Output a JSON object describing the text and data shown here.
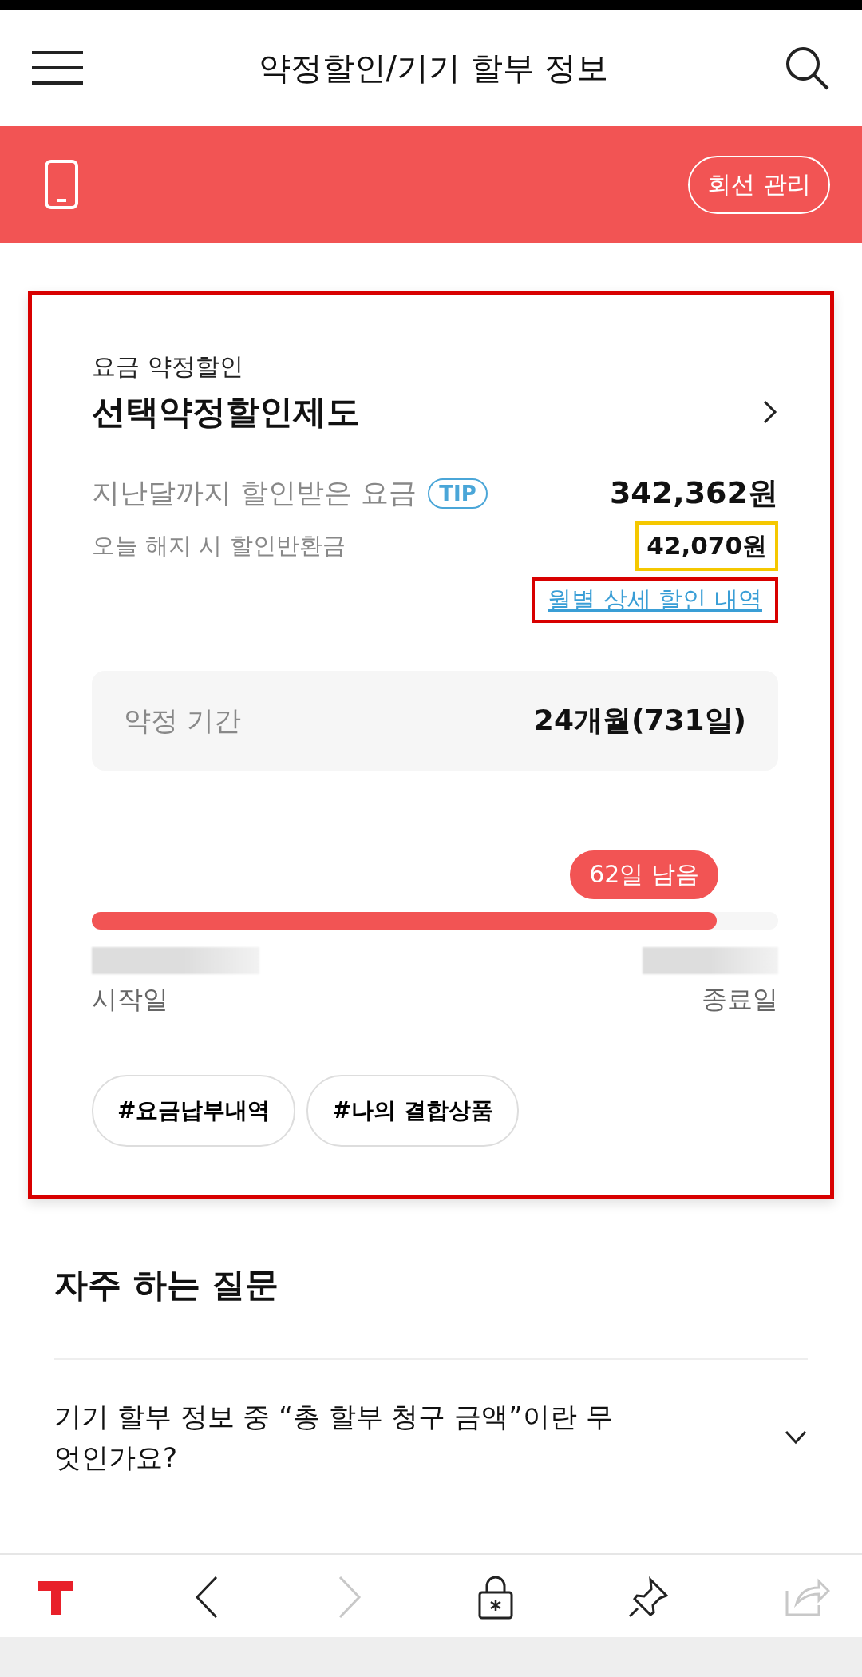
{
  "header": {
    "title": "약정할인/기기 할부 정보"
  },
  "line_bar": {
    "button": "회선 관리"
  },
  "discount_card": {
    "category": "요금 약정할인",
    "title": "선택약정할인제도",
    "rows": [
      {
        "label": "지난달까지 할인받은 요금",
        "tip": "TIP",
        "value": "342,362원"
      },
      {
        "label": "오늘 해지 시 할인반환금",
        "value": "42,070원",
        "color": "#f5c800"
      }
    ],
    "detail_link": {
      "label": "월별 상세 할인 내역",
      "color": "#d80000"
    },
    "period": {
      "label": "약정 기간",
      "value": "24개월(731일)"
    },
    "remaining": "62일 남음",
    "progress": {
      "level": 0.91
    },
    "start_label": "시작일",
    "end_label": "종료일",
    "tags": [
      "#요금납부내역",
      "#나의 결합상품"
    ],
    "color": "#d80000"
  },
  "faq": {
    "title": "자주 하는 질문",
    "items": [
      {
        "question": "기기 할부 정보 중 “총 할부 청구 금액”이란 무엇인가요?",
        "expanded": false
      }
    ]
  },
  "bottom_nav": [
    {
      "kind": "home",
      "disabled": false
    },
    {
      "kind": "back",
      "disabled": false
    },
    {
      "kind": "forward",
      "disabled": true
    },
    {
      "kind": "secure",
      "disabled": false
    },
    {
      "kind": "pin",
      "disabled": false
    },
    {
      "kind": "share",
      "disabled": true
    }
  ]
}
